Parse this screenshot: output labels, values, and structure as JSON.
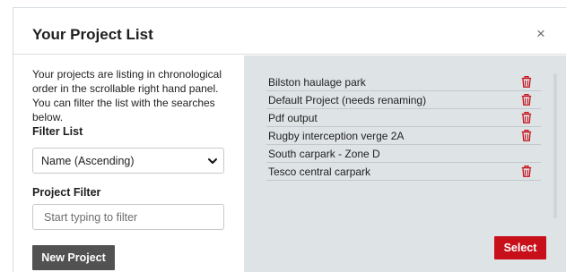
{
  "modal": {
    "title": "Your Project List",
    "close_symbol": "×"
  },
  "left": {
    "intro": "Your projects are listing in chronological order in the scrollable right hand panel. You can filter the list with the searches below.",
    "filter_list_label": "Filter List",
    "filter_list_selected": "Name (Ascending)",
    "project_filter_label": "Project Filter",
    "project_filter_placeholder": "Start typing to filter",
    "new_project_label": "New Project"
  },
  "projects": [
    {
      "name": "Bilston haulage park",
      "deletable": true
    },
    {
      "name": "Default Project (needs renaming)",
      "deletable": true
    },
    {
      "name": "Pdf output",
      "deletable": true
    },
    {
      "name": "Rugby interception verge 2A",
      "deletable": true
    },
    {
      "name": "South carpark - Zone D",
      "deletable": false
    },
    {
      "name": "Tesco central carpark",
      "deletable": true
    }
  ],
  "select_label": "Select",
  "colors": {
    "accent_red": "#c8101a",
    "panel_bg": "#dee3e6",
    "dark_button": "#525252"
  },
  "icons": {
    "close": "close-icon",
    "dropdown": "chevron-down-icon",
    "delete": "trash-icon"
  }
}
